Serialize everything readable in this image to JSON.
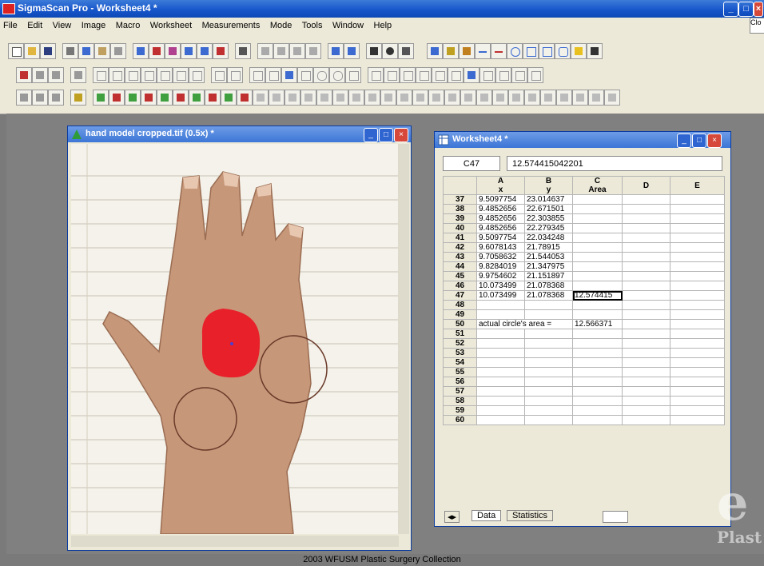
{
  "app": {
    "title": "SigmaScan Pro - Worksheet4 *",
    "controls": {
      "min": "_",
      "max": "□",
      "close": "×"
    }
  },
  "menu": [
    "File",
    "Edit",
    "View",
    "Image",
    "Macro",
    "Worksheet",
    "Measurements",
    "Mode",
    "Tools",
    "Window",
    "Help"
  ],
  "right_panel_label": "Clo",
  "image_window": {
    "title": "hand model cropped.tif (0.5x) *"
  },
  "worksheet_window": {
    "title": "Worksheet4 *"
  },
  "cell_ref": "C47",
  "cell_value": "12.574415042201",
  "columns": [
    {
      "letter": "A",
      "label": "x"
    },
    {
      "letter": "B",
      "label": "y"
    },
    {
      "letter": "C",
      "label": "Area"
    },
    {
      "letter": "D",
      "label": ""
    },
    {
      "letter": "E",
      "label": ""
    }
  ],
  "rows": [
    {
      "n": "37",
      "a": "9.5097754",
      "b": "23.014637",
      "c": ""
    },
    {
      "n": "38",
      "a": "9.4852656",
      "b": "22.671501",
      "c": ""
    },
    {
      "n": "39",
      "a": "9.4852656",
      "b": "22.303855",
      "c": ""
    },
    {
      "n": "40",
      "a": "9.4852656",
      "b": "22.279345",
      "c": ""
    },
    {
      "n": "41",
      "a": "9.5097754",
      "b": "22.034248",
      "c": ""
    },
    {
      "n": "42",
      "a": "9.6078143",
      "b": "21.78915",
      "c": ""
    },
    {
      "n": "43",
      "a": "9.7058632",
      "b": "21.544053",
      "c": ""
    },
    {
      "n": "44",
      "a": "9.8284019",
      "b": "21.347975",
      "c": ""
    },
    {
      "n": "45",
      "a": "9.9754602",
      "b": "21.151897",
      "c": ""
    },
    {
      "n": "46",
      "a": "10.073499",
      "b": "21.078368",
      "c": ""
    },
    {
      "n": "47",
      "a": "10.073499",
      "b": "21.078368",
      "c": "12.574415"
    },
    {
      "n": "48",
      "a": "",
      "b": "",
      "c": ""
    },
    {
      "n": "49",
      "a": "",
      "b": "",
      "c": ""
    },
    {
      "n": "50",
      "a": "actual circle's area =",
      "b": "",
      "c": "12.566371"
    },
    {
      "n": "51",
      "a": "",
      "b": "",
      "c": ""
    },
    {
      "n": "52",
      "a": "",
      "b": "",
      "c": ""
    },
    {
      "n": "53",
      "a": "",
      "b": "",
      "c": ""
    },
    {
      "n": "54",
      "a": "",
      "b": "",
      "c": ""
    },
    {
      "n": "55",
      "a": "",
      "b": "",
      "c": ""
    },
    {
      "n": "56",
      "a": "",
      "b": "",
      "c": ""
    },
    {
      "n": "57",
      "a": "",
      "b": "",
      "c": ""
    },
    {
      "n": "58",
      "a": "",
      "b": "",
      "c": ""
    },
    {
      "n": "59",
      "a": "",
      "b": "",
      "c": ""
    },
    {
      "n": "60",
      "a": "",
      "b": "",
      "c": ""
    }
  ],
  "sheet_tabs": [
    "Data",
    "Statistics"
  ],
  "credit": "2003 WFUSM Plastic Surgery Collection",
  "watermark": {
    "letter": "e",
    "text": "Plast"
  },
  "colors": {
    "titlebar": "#1554c9",
    "selection_fill": "#e8202a",
    "circle_outline": "#6b3a2a"
  }
}
